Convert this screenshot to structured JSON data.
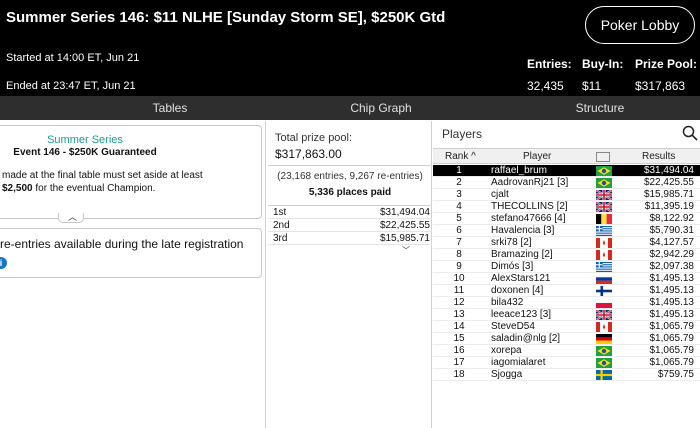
{
  "header": {
    "title": "Summer Series 146: $11 NLHE [Sunday Storm SE], $250K Gtd",
    "lobby_button": "Poker Lobby",
    "started": "Started at 14:00 ET, Jun 21",
    "ended": "Ended at 23:47 ET, Jun 21",
    "entries_label": "Entries:",
    "entries_value": "32,435",
    "buyin_label": "Buy-In:",
    "buyin_value": "$11",
    "prizepool_label": "Prize Pool:",
    "prizepool_value": "$317,863"
  },
  "tabs": [
    "Tables",
    "Chip Graph",
    "Structure"
  ],
  "info_card": {
    "series": "Summer Series",
    "event": "Event 146 - $250K Guaranteed",
    "rule_line1": "made at the final table must set aside at least",
    "rule_amount": "$2,500",
    "rule_line2_rest": " for the eventual Champion."
  },
  "reentry": {
    "text": "re-entries available during the late registration",
    "icon": "info-icon"
  },
  "prize": {
    "pool_label": "Total prize pool:",
    "pool_value": "$317,863.00",
    "entries_note": "(23,168 entries, 9,267 re-entries)",
    "places_paid": "5,336 places paid",
    "payouts": [
      {
        "place": "1st",
        "amount": "$31,494.04"
      },
      {
        "place": "2nd",
        "amount": "$22,425.55"
      },
      {
        "place": "3rd",
        "amount": "$15,985.71"
      }
    ]
  },
  "players": {
    "title": "Players",
    "col_rank": "Rank",
    "col_player": "Player",
    "col_results": "Results",
    "rows": [
      {
        "rank": "1",
        "name": "raffael_brum",
        "flag": "BR",
        "result": "$31,494.04"
      },
      {
        "rank": "2",
        "name": "AadrovanRj21 [3]",
        "flag": "BR",
        "result": "$22,425.55"
      },
      {
        "rank": "3",
        "name": "cjalt",
        "flag": "GB",
        "result": "$15,985.71"
      },
      {
        "rank": "4",
        "name": "THECOLLINS [2]",
        "flag": "GB",
        "result": "$11,395.19"
      },
      {
        "rank": "5",
        "name": "stefano47666 [4]",
        "flag": "BE",
        "result": "$8,122.92"
      },
      {
        "rank": "6",
        "name": "Havalencia [3]",
        "flag": "GR",
        "result": "$5,790.31"
      },
      {
        "rank": "7",
        "name": "srki78 [2]",
        "flag": "CA",
        "result": "$4,127.57"
      },
      {
        "rank": "8",
        "name": "Bramazing [2]",
        "flag": "CA",
        "result": "$2,942.29"
      },
      {
        "rank": "9",
        "name": "Dimós [3]",
        "flag": "GR",
        "result": "$2,097.38"
      },
      {
        "rank": "10",
        "name": "AlexStars121",
        "flag": "RU",
        "result": "$1,495.13"
      },
      {
        "rank": "11",
        "name": "doxonen [4]",
        "flag": "FI",
        "result": "$1,495.13"
      },
      {
        "rank": "12",
        "name": "bila432",
        "flag": "PL",
        "result": "$1,495.13"
      },
      {
        "rank": "13",
        "name": "leeace123 [3]",
        "flag": "GB",
        "result": "$1,495.13"
      },
      {
        "rank": "14",
        "name": "SteveD54",
        "flag": "CA",
        "result": "$1,065.79"
      },
      {
        "rank": "15",
        "name": "saladin@nlg [2]",
        "flag": "DE",
        "result": "$1,065.79"
      },
      {
        "rank": "16",
        "name": "xorepa",
        "flag": "BR",
        "result": "$1,065.79"
      },
      {
        "rank": "17",
        "name": "iagomialaret",
        "flag": "BR",
        "result": "$1,065.79"
      },
      {
        "rank": "18",
        "name": "Sjogga",
        "flag": "SE",
        "result": "$759.75"
      }
    ]
  },
  "colors": {
    "header_bg": "#000000",
    "tabbar_bg": "#2e2e2e",
    "series_accent": "#1a9b8f",
    "selected_row": "#000000"
  }
}
